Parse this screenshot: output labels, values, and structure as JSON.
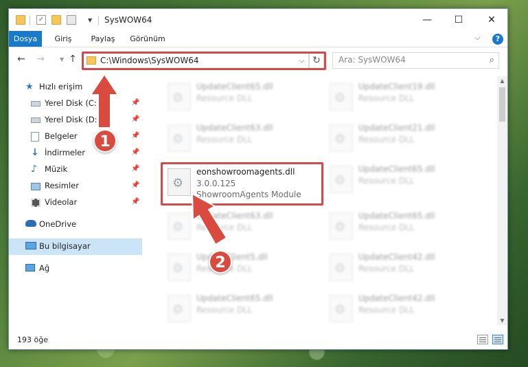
{
  "window": {
    "title": "SysWOW64",
    "minimize": "—",
    "maximize": "☐",
    "close": "✕"
  },
  "ribbon": {
    "tabs": [
      "Dosya",
      "Giriş",
      "Paylaş",
      "Görünüm"
    ],
    "help": "?"
  },
  "nav": {
    "back": "←",
    "forward": "→",
    "up": "↑",
    "address": "C:\\Windows\\SysWOW64",
    "refresh": "↻",
    "search_placeholder": "Ara: SysWOW64"
  },
  "sidebar": {
    "items": [
      {
        "label": "Hızlı erişim",
        "icon": "star-icon"
      },
      {
        "label": "Yerel Disk (C:)",
        "icon": "drive-icon"
      },
      {
        "label": "Yerel Disk (D:)",
        "icon": "drive-icon"
      },
      {
        "label": "Belgeler",
        "icon": "documents-icon"
      },
      {
        "label": "İndirmeler",
        "icon": "download-icon"
      },
      {
        "label": "Müzik",
        "icon": "music-icon"
      },
      {
        "label": "Resimler",
        "icon": "pictures-icon"
      },
      {
        "label": "Videolar",
        "icon": "videos-icon"
      },
      {
        "label": "OneDrive",
        "icon": "cloud-icon"
      },
      {
        "label": "Bu bilgisayar",
        "icon": "computer-icon"
      },
      {
        "label": "Ağ",
        "icon": "network-icon"
      }
    ]
  },
  "files": {
    "left": [
      {
        "name": "UpdateClient65.dll",
        "ver": "Resource DLL",
        "desc": ""
      },
      {
        "name": "UpdateClient63.dll",
        "ver": "Resource DLL",
        "desc": ""
      },
      {
        "name": "eonshowroomagents.dll",
        "ver": "3.0.0.125",
        "desc": "ShowroomAgents Module"
      },
      {
        "name": "UpdateClient63.dll",
        "ver": "Resource DLL",
        "desc": ""
      },
      {
        "name": "UpdateClient5.dll",
        "ver": "Resource DLL",
        "desc": ""
      },
      {
        "name": "UpdateClient65.dll",
        "ver": "Resource DLL",
        "desc": ""
      }
    ],
    "right": [
      {
        "name": "UpdateClient19.dll",
        "ver": "Resource DLL"
      },
      {
        "name": "UpdateClient21.dll",
        "ver": "Resource DLL"
      },
      {
        "name": "UpdateClient65.dll",
        "ver": "Resource DLL"
      },
      {
        "name": "UpdateClient65.dll",
        "ver": "Resource DLL"
      },
      {
        "name": "UpdateClient42.dll",
        "ver": "Resource DLL"
      },
      {
        "name": "UpdateClient42.dll",
        "ver": "Resource DLL"
      }
    ]
  },
  "status": {
    "count": "193 öğe"
  },
  "annotations": {
    "step1": "1",
    "step2": "2",
    "color": "#d94a3f"
  }
}
